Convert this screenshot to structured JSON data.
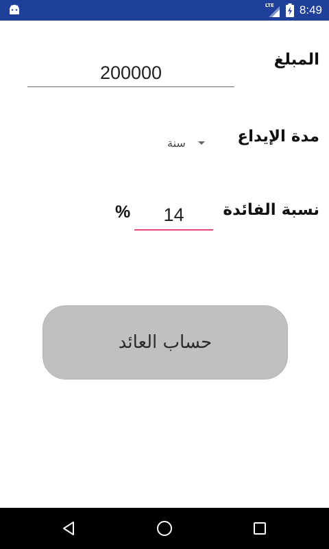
{
  "status_bar": {
    "time": "8:49",
    "network_label": "LTE",
    "icons": [
      "android-icon",
      "lte-signal-icon",
      "battery-charging-icon"
    ],
    "background_color": "#1e3f9a"
  },
  "form": {
    "amount": {
      "label": "المبلغ",
      "value": "200000"
    },
    "duration": {
      "label": "مدة الإيداع",
      "selected": "سنة"
    },
    "rate": {
      "label": "نسبة الفائدة",
      "value": "14",
      "suffix": "%",
      "underline_color": "#e4437e"
    }
  },
  "button": {
    "label": "حساب العائد"
  },
  "nav_bar": {
    "icons": [
      "back-icon",
      "home-icon",
      "recents-icon"
    ]
  }
}
